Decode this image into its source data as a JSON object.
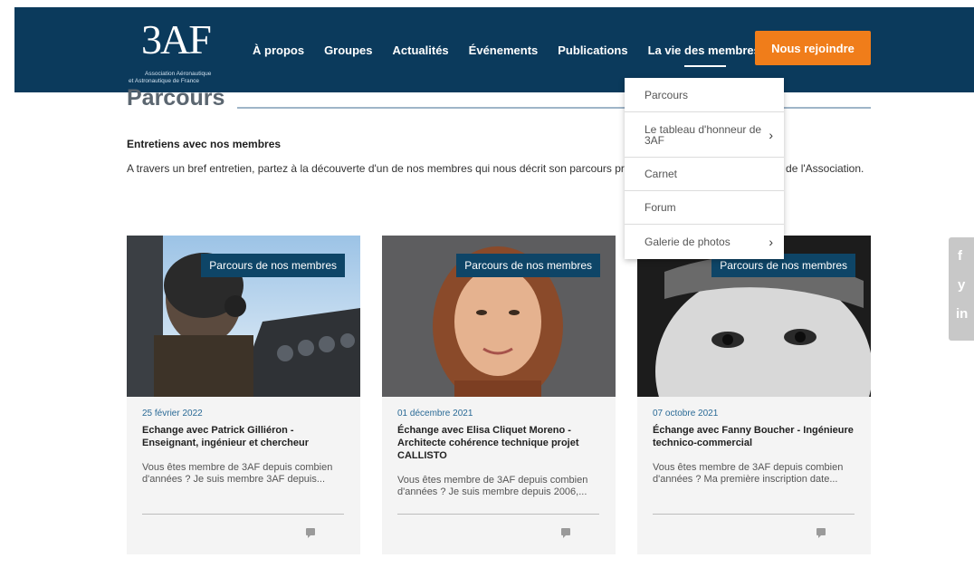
{
  "logo": {
    "mark": "3AF",
    "line1": "Association Aéronautique",
    "line2": "et Astronautique de France"
  },
  "nav": {
    "items": [
      "À propos",
      "Groupes",
      "Actualités",
      "Événements",
      "Publications",
      "La vie des membres"
    ],
    "active_index": 5,
    "join_label": "Nous rejoindre"
  },
  "page": {
    "title": "Parcours",
    "section_title": "Entretiens avec nos membres",
    "intro": "A travers un bref entretien, partez à la découverte d'un de nos membres qui nous décrit son parcours professionnel, ses activités au sein de l'Association."
  },
  "dropdown": {
    "items": [
      {
        "label": "Parcours",
        "chevron": false
      },
      {
        "label": "Le tableau d'honneur de 3AF",
        "chevron": true
      },
      {
        "label": "Carnet",
        "chevron": false
      },
      {
        "label": "Forum",
        "chevron": false
      },
      {
        "label": "Galerie de photos",
        "chevron": true
      }
    ]
  },
  "cards": [
    {
      "tag": "Parcours de nos membres",
      "date": "25 février 2022",
      "title": "Echange avec Patrick Gilliéron - Enseignant, ingénieur et chercheur",
      "excerpt": "Vous êtes membre de 3AF depuis combien d'années ? Je suis membre 3AF depuis..."
    },
    {
      "tag": "Parcours de nos membres",
      "date": "01 décembre 2021",
      "title": "Échange avec Elisa Cliquet Moreno - Architecte cohérence technique projet CALLISTO",
      "excerpt": "Vous êtes membre de 3AF depuis combien d'années ? Je suis membre depuis 2006,..."
    },
    {
      "tag": "Parcours de nos membres",
      "date": "07 octobre 2021",
      "title": "Échange avec Fanny Boucher - Ingénieure technico-commercial",
      "excerpt": "Vous êtes membre de 3AF depuis combien d'années ? Ma première inscription date..."
    }
  ],
  "social": {
    "icons": [
      "facebook-icon",
      "twitter-icon",
      "linkedin-icon"
    ],
    "glyphs": [
      "f",
      "y",
      "in"
    ]
  },
  "colors": {
    "header": "#0b3a5c",
    "accent": "#f07d1a",
    "tag": "#0e4567"
  }
}
